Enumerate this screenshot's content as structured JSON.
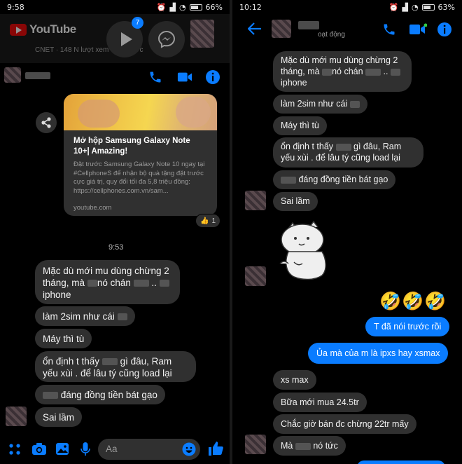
{
  "left": {
    "status_time": "9:58",
    "battery": "66%",
    "youtube_logo": "YouTube",
    "video_sub": "CNET · 148 N lượt xem",
    "video_sub_tail": "trước",
    "bubble_badge": "7",
    "link_card": {
      "title": "Mở hộp Samsung Galaxy Note 10+| Amazing!",
      "description": "Đặt trước Samsung Galaxy Note 10 ngay tại #CellphoneS để nhận bộ quà tặng đặt trước cực giá trị, quy đổi tối đa 5,8 triệu đồng: https://cellphones.com.vn/sam...",
      "domain": "youtube.com",
      "reaction_count": "1"
    },
    "timestamp": "9:53",
    "messages": [
      {
        "l1": "Mặc dù mới mu dùng chừng 2",
        "l2a": "tháng, mà",
        "l2b": "nó chán",
        "l2c": "..",
        "l3": "iphone"
      },
      {
        "a": "làm 2sim như cái"
      },
      {
        "a": "Máy thì tù"
      },
      {
        "l1a": "ổn định t thấy",
        "l1b": "gì đâu, Ram",
        "l2": "yếu xùi . để lâu tý cũng load lại"
      },
      {
        "a": "đáng đồng tiền bát gạo"
      },
      {
        "a": "Sai lầm"
      }
    ],
    "composer_placeholder": "Aa"
  },
  "right": {
    "status_time": "10:12",
    "battery": "63%",
    "header_status": "oạt động",
    "messages": [
      {
        "l1": "Mặc dù mới mu dùng chừng 2",
        "l2a": "tháng, mà",
        "l2b": "nó chán",
        "l2c": "..",
        "l3": "iphone"
      },
      {
        "a": "làm 2sim như cái"
      },
      {
        "a": "Máy thì tù"
      },
      {
        "l1a": "ổn định t thấy",
        "l1b": "gì đâu, Ram",
        "l2": "yếu xùi . để lâu tý cũng load lại"
      },
      {
        "a": "đáng đồng tiền bát gạo"
      },
      {
        "a": "Sai lầm"
      }
    ],
    "laugh_emojis": "🤣🤣🤣",
    "my_messages": [
      "T đã nói trước rồi",
      "Ủa mà của m là ipxs hay xsmax"
    ],
    "replies": [
      "xs max",
      "Bữa mới mua 24.5tr",
      "Chắc giờ bán đc chừng 22tr mấy"
    ],
    "last_a": "Mà",
    "last_b": "nó tức"
  },
  "colors": {
    "accent": "#0a7cff",
    "incoming": "#303030",
    "background": "#000000"
  }
}
